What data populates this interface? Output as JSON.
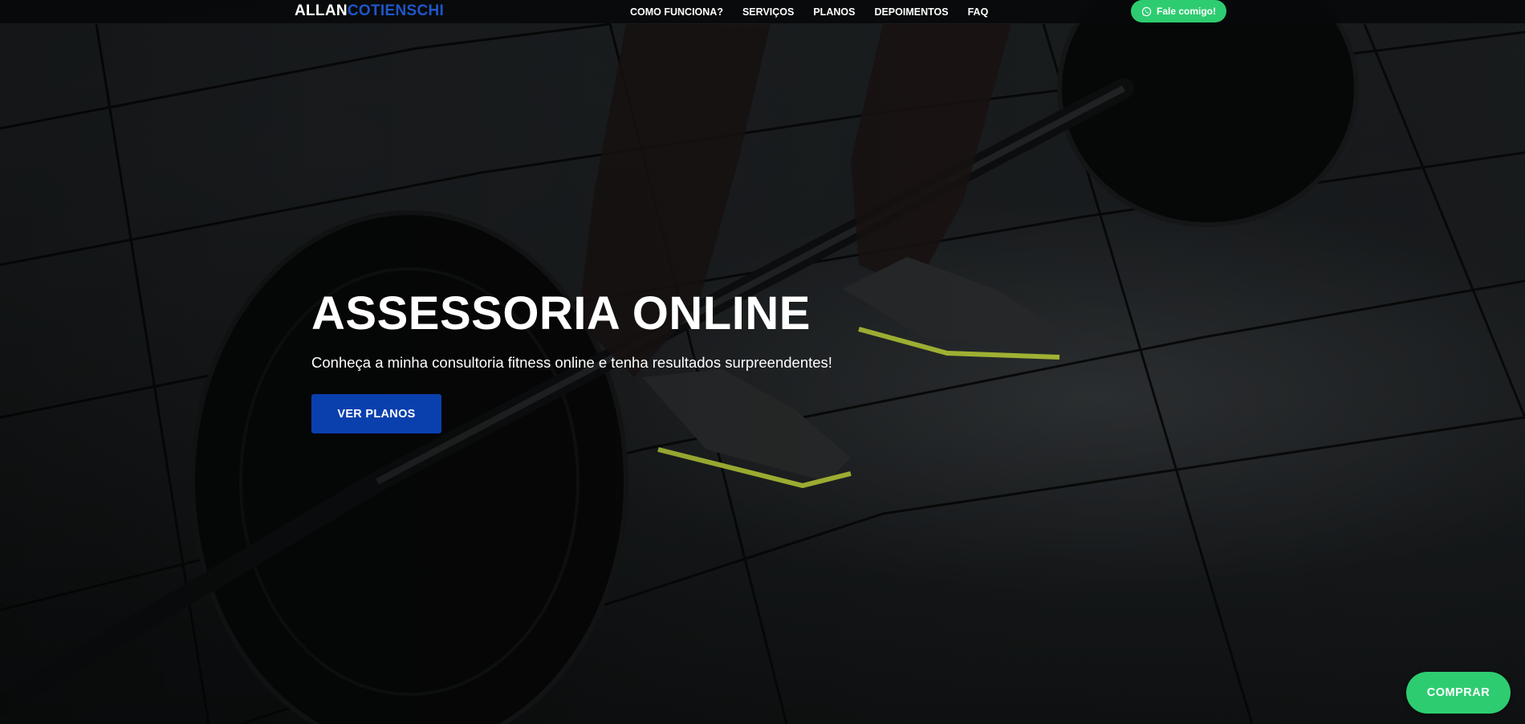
{
  "header": {
    "logo_first": "ALLAN",
    "logo_second": "COTIENSCHI",
    "nav": [
      {
        "label": "COMO FUNCIONA?"
      },
      {
        "label": "SERVIÇOS"
      },
      {
        "label": "PLANOS"
      },
      {
        "label": "DEPOIMENTOS"
      },
      {
        "label": "FAQ"
      }
    ],
    "whatsapp": {
      "label": "Fale comigo!",
      "icon": "whatsapp-icon"
    }
  },
  "hero": {
    "title": "ASSESSORIA ONLINE",
    "subtitle": "Conheça a minha consultoria fitness online e tenha resultados surpreendentes!",
    "cta_label": "VER PLANOS"
  },
  "floating": {
    "buy_label": "COMPRAR"
  },
  "colors": {
    "brand_blue": "#1f56c9",
    "cta_blue": "#0a3fae",
    "whatsapp_green": "#2ecc71",
    "topbar": "#08090a"
  }
}
